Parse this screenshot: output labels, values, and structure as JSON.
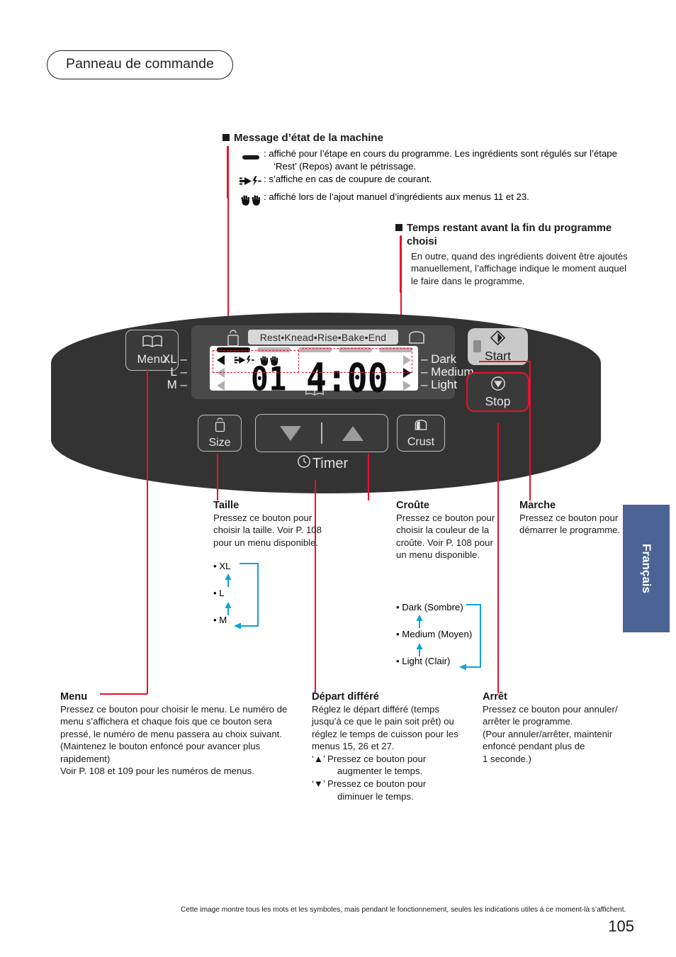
{
  "title": "Panneau de commande",
  "status_block": {
    "heading": "Message d’état de la machine",
    "rows": [
      {
        "icon": "solid-bar-icon",
        "line1": ": affiché pour l’étape en cours du programme. Les ingrédients sont régulés sur l’étape",
        "line2": "‘Rest’ (Repos) avant le pétrissage."
      },
      {
        "icon": "power-plug-icon",
        "line1": ": s’affiche en cas de coupure de courant.",
        "line2": ""
      },
      {
        "icon": "hands-icon",
        "line1": ": affiché lors de l’ajout manuel d’ingrédients aux menus 11 et 23.",
        "line2": ""
      }
    ]
  },
  "time_block": {
    "heading_line1": "Temps restant avant la fin du programme",
    "heading_line2": "choisi",
    "body": "En outre, quand des ingrédients doivent être ajoutés manuellement, l’affichage indique le moment auquel le faire dans le programme."
  },
  "panel": {
    "menu_button": "Menu",
    "start_button": "Start",
    "stop_button": "Stop",
    "size_button": "Size",
    "crust_button": "Crust",
    "timer_label": "Timer",
    "stage_bar": "Rest•Knead•Rise•Bake•End",
    "lcd": {
      "menu_number": "01",
      "time": "4:00",
      "size_labels": [
        "XL",
        "L",
        "M"
      ],
      "size_selected": "XL",
      "crust_labels": [
        "Dark",
        "Medium",
        "Light"
      ],
      "crust_selected": "Medium",
      "stage_selected_index": 0
    }
  },
  "captions": {
    "taille": {
      "heading": "Taille",
      "body": "Pressez ce bouton pour choisir la taille. Voir P. 108 pour un menu disponible.",
      "options": [
        "XL",
        "L",
        "M"
      ]
    },
    "croute": {
      "heading": "Croûte",
      "body": "Pressez ce bouton pour choisir la couleur de la croûte. Voir P. 108 pour un menu disponible.",
      "options": [
        "Dark (Sombre)",
        "Medium (Moyen)",
        "Light (Clair)"
      ]
    },
    "marche": {
      "heading": "Marche",
      "body": "Pressez ce bouton pour démarrer le programme."
    },
    "menu": {
      "heading": "Menu",
      "body": "Pressez ce bouton pour choisir le menu. Le numéro de menu s’affichera et chaque fois que ce bouton sera pressé, le numéro de menu passera au choix suivant.\n(Maintenez le bouton enfoncé pour avancer plus rapidement)\nVoir P. 108 et 109 pour les numéros de menus."
    },
    "depart": {
      "heading": "Départ différé",
      "body": "Réglez le départ différé (temps jusqu’à ce que le pain soit prêt) ou réglez le temps de cuisson pour les menus 15, 26 et 27.",
      "up_symbol": "‘▲’",
      "up_text_l1": "Pressez ce bouton pour",
      "up_text_l2": "augmenter le temps.",
      "down_symbol": "‘▼’",
      "down_text_l1": "Pressez ce bouton pour",
      "down_text_l2": "diminuer le temps."
    },
    "arret": {
      "heading": "Arrêt",
      "body": "Pressez ce bouton pour annuler/ arrêter le programme.\n(Pour annuler/arrêter, maintenir enfoncé pendant plus de\n1 seconde.)"
    }
  },
  "side_tab": "Français",
  "footer_note": "Cette image montre tous les mots et les symboles, mais pendant le fonctionnement, seules les indications utiles à ce moment-là s’affichent.",
  "page_number": "105",
  "colors": {
    "callout_red": "#e8112d",
    "cycle_blue": "#0aa3dc",
    "tab_blue": "#4c6395",
    "panel_dark": "#333333"
  }
}
